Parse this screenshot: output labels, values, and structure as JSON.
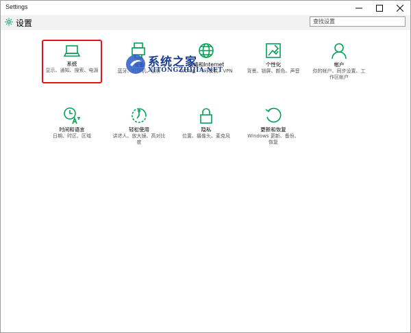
{
  "window": {
    "title": "Settings",
    "controls": [
      "minimize",
      "maximize",
      "close"
    ]
  },
  "header": {
    "title": "设置",
    "icon": "gear-icon",
    "search_placeholder": "查找设置"
  },
  "tiles": [
    {
      "name": "系统",
      "desc": "显示、通知、搜索、电源",
      "icon": "laptop-icon",
      "highlighted": true
    },
    {
      "name": "设备",
      "desc": "蓝牙、打印机、鼠标",
      "icon": "devices-icon"
    },
    {
      "name": "网络和Internet",
      "desc": "WLAN、飞行模式、VPN",
      "icon": "globe-icon"
    },
    {
      "name": "个性化",
      "desc": "背景、锁屏、颜色、声音",
      "icon": "personalization-icon"
    },
    {
      "name": "帐户",
      "desc": "你的帐户、同步设置、工作区帐户",
      "icon": "person-icon"
    },
    {
      "name": "时间和语言",
      "desc": "日期、时区、区域",
      "icon": "time-language-icon"
    },
    {
      "name": "轻松使用",
      "desc": "讲述人、放大镜、高对比度",
      "icon": "ease-of-access-icon"
    },
    {
      "name": "隐私",
      "desc": "位置、摄像头、麦克风",
      "icon": "lock-icon"
    },
    {
      "name": "更新和恢复",
      "desc": "Windows 更新、备份、恢复",
      "icon": "update-icon"
    }
  ],
  "watermark": {
    "cn": "系统之家",
    "en": "XITONGZHIJIA.NET"
  },
  "colors": {
    "accent": "#00a251",
    "highlight_border": "#e0141d",
    "header_bg": "#f2f2f2"
  }
}
